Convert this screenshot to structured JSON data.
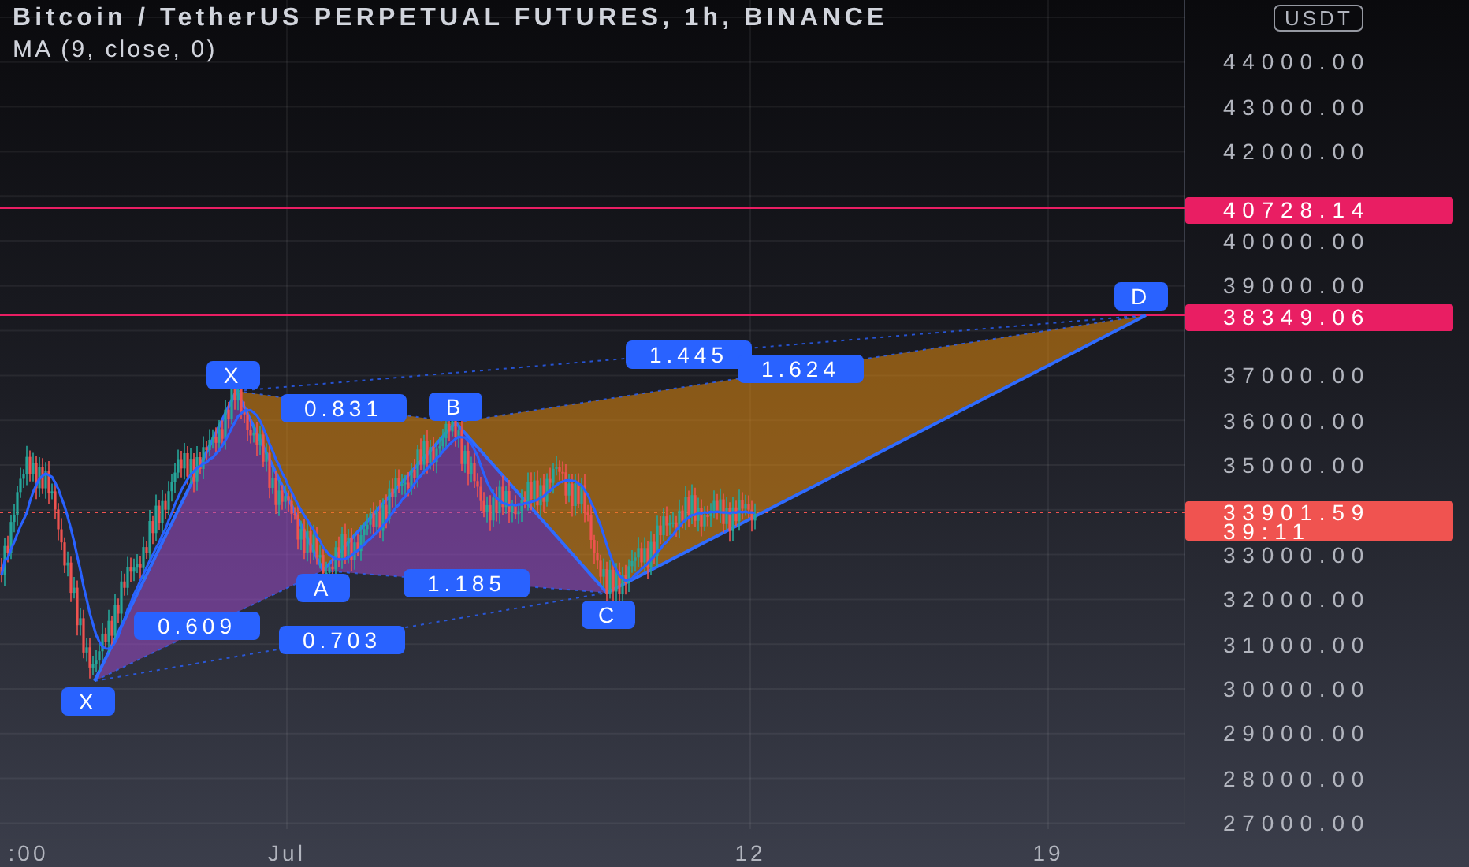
{
  "header": {
    "title": "Bitcoin / TetherUS PERPETUAL FUTURES, 1h, BINANCE",
    "indicator": "MA (9, close, 0)"
  },
  "price_axis": {
    "currency": "USDT",
    "labels": [
      "44000.00",
      "43000.00",
      "42000.00",
      "40000.00",
      "39000.00",
      "37000.00",
      "36000.00",
      "35000.00",
      "33000.00",
      "32000.00",
      "31000.00",
      "30000.00",
      "29000.00",
      "28000.00",
      "27000.00"
    ]
  },
  "price_lines": [
    {
      "kind": "level",
      "price": "40728.14",
      "color": "#e91e63"
    },
    {
      "kind": "level",
      "price": "38349.06",
      "color": "#e91e63"
    },
    {
      "kind": "last",
      "price": "33901.59",
      "countdown": "39:11",
      "color": "#f05350"
    }
  ],
  "pattern": {
    "points": [
      {
        "label": "X"
      },
      {
        "label": "X"
      },
      {
        "label": "A"
      },
      {
        "label": "B"
      },
      {
        "label": "C"
      },
      {
        "label": "D"
      }
    ],
    "ratios": [
      {
        "label": "0.831"
      },
      {
        "label": "1.185"
      },
      {
        "label": "0.609"
      },
      {
        "label": "0.703"
      },
      {
        "label": "1.445"
      },
      {
        "label": "1.624"
      }
    ]
  },
  "time_axis": {
    "labels": [
      ":00",
      "Jul",
      "12",
      "19"
    ]
  }
}
